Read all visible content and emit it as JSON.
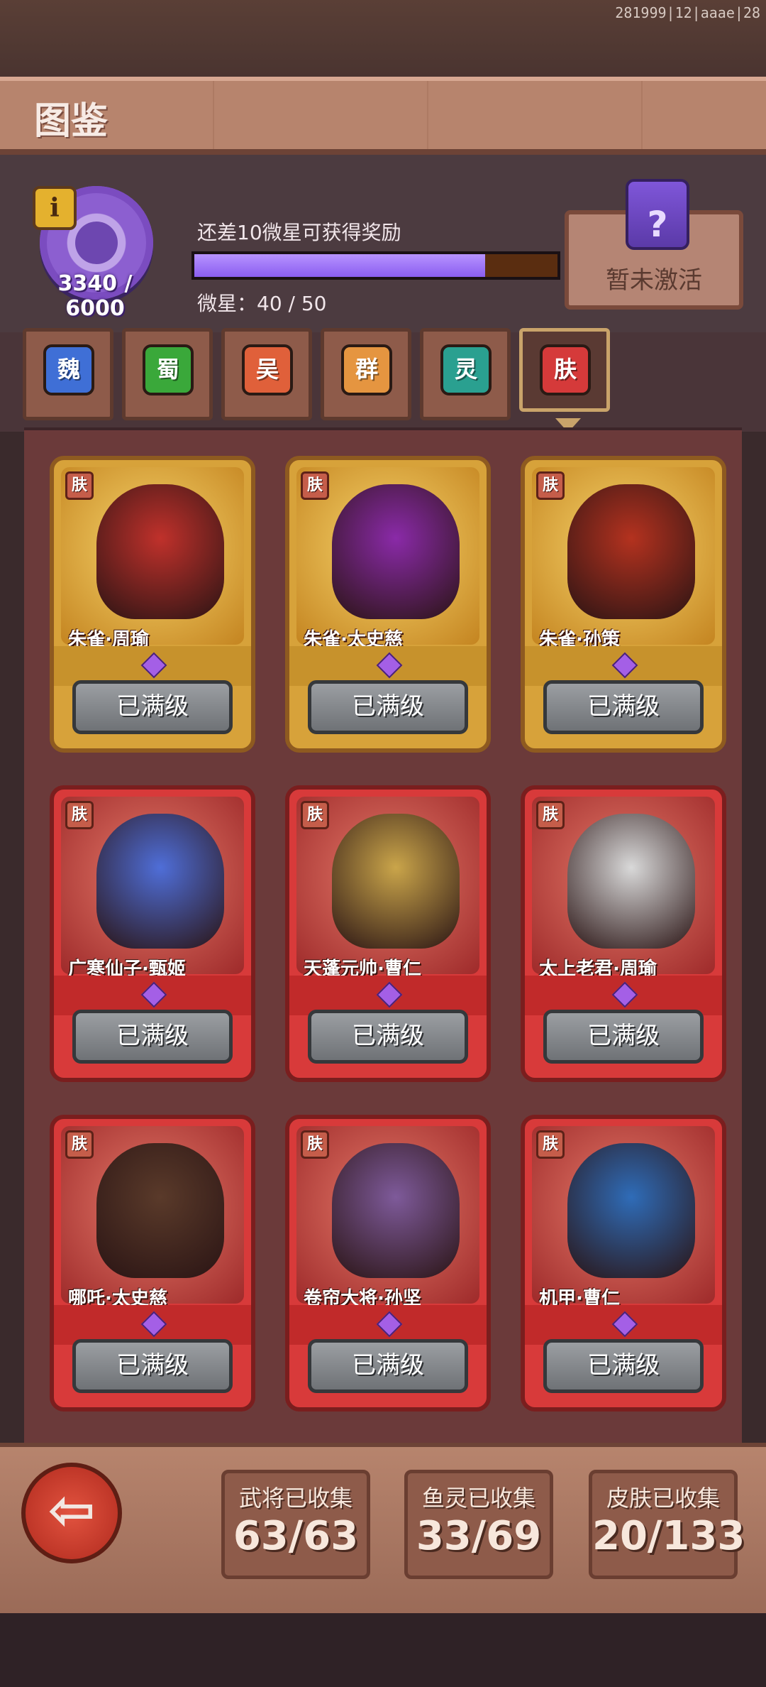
{
  "debug": "281999|12|aaae|28",
  "header": {
    "title": "图鉴"
  },
  "progress": {
    "collection_count": "3340 / 6000",
    "reward_hint": "还差10微星可获得奖励",
    "star_label": "微星：40 / 50",
    "fraction": 0.8,
    "inactive_label": "暂未激活",
    "mystery_glyph": "?"
  },
  "tabs": [
    {
      "label": "魏",
      "color": "#3f6fd6"
    },
    {
      "label": "蜀",
      "color": "#3aa83a"
    },
    {
      "label": "吴",
      "color": "#e0603a"
    },
    {
      "label": "群",
      "color": "#e59540"
    },
    {
      "label": "灵",
      "color": "#2aa090"
    },
    {
      "label": "肤",
      "color": "#d53a3a"
    }
  ],
  "cards": [
    {
      "tag": "肤",
      "name": "朱雀·周瑜",
      "button": "已满级",
      "tier": "gold",
      "figure_color": "#c0312b"
    },
    {
      "tag": "肤",
      "name": "朱雀·太史慈",
      "button": "已满级",
      "tier": "gold",
      "figure_color": "#8a2aa8"
    },
    {
      "tag": "肤",
      "name": "朱雀·孙策",
      "button": "已满级",
      "tier": "gold",
      "figure_color": "#b4321f"
    },
    {
      "tag": "肤",
      "name": "广寒仙子·甄姬",
      "button": "已满级",
      "tier": "red",
      "figure_color": "#4f6ed8"
    },
    {
      "tag": "肤",
      "name": "天蓬元帅·曹仁",
      "button": "已满级",
      "tier": "red",
      "figure_color": "#caa54a"
    },
    {
      "tag": "肤",
      "name": "太上老君·周瑜",
      "button": "已满级",
      "tier": "red",
      "figure_color": "#d9d9d9"
    },
    {
      "tag": "肤",
      "name": "哪吒·太史慈",
      "button": "已满级",
      "tier": "red",
      "figure_color": "#5a3a2a"
    },
    {
      "tag": "肤",
      "name": "卷帘大将·孙坚",
      "button": "已满级",
      "tier": "red",
      "figure_color": "#7e5a9a"
    },
    {
      "tag": "肤",
      "name": "机甲·曹仁",
      "button": "已满级",
      "tier": "red",
      "figure_color": "#2f6cb8"
    }
  ],
  "stats": [
    {
      "label": "武将已收集",
      "value": "63/63"
    },
    {
      "label": "鱼灵已收集",
      "value": "33/69"
    },
    {
      "label": "皮肤已收集",
      "value": "20/133"
    }
  ],
  "back_glyph": "⇦"
}
